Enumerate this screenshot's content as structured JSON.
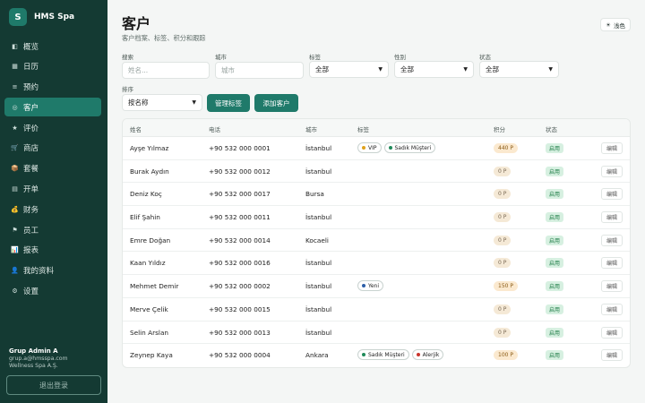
{
  "brand": {
    "logo": "S",
    "name": "HMS Spa"
  },
  "nav": [
    {
      "icon": "◧",
      "label": "概览",
      "active": false
    },
    {
      "icon": "▦",
      "label": "日历",
      "active": false
    },
    {
      "icon": "≡",
      "label": "预约",
      "active": false
    },
    {
      "icon": "◎",
      "label": "客户",
      "active": true
    },
    {
      "icon": "★",
      "label": "评价",
      "active": false
    },
    {
      "icon": "🛒",
      "label": "商店",
      "active": false
    },
    {
      "icon": "📦",
      "label": "套餐",
      "active": false
    },
    {
      "icon": "▤",
      "label": "开单",
      "active": false
    },
    {
      "icon": "💰",
      "label": "财务",
      "active": false
    },
    {
      "icon": "⚑",
      "label": "员工",
      "active": false
    },
    {
      "icon": "📊",
      "label": "报表",
      "active": false
    },
    {
      "icon": "👤",
      "label": "我的资料",
      "active": false
    },
    {
      "icon": "⚙",
      "label": "设置",
      "active": false
    }
  ],
  "user": {
    "name": "Grup Admin A",
    "email": "grup.a@hmsspa.com",
    "company": "Wellness Spa A.Ş."
  },
  "logout_label": "退出登录",
  "page": {
    "title": "客户",
    "subtitle": "客户档案、标签、积分和跟踪"
  },
  "theme_button": {
    "icon": "☀",
    "label": "浅色"
  },
  "filters": {
    "search_label": "搜索",
    "search_placeholder": "姓名...",
    "city_label": "城市",
    "city_placeholder": "城市",
    "tag_label": "标签",
    "tag_value": "全部",
    "gender_label": "性别",
    "gender_value": "全部",
    "status_label": "状态",
    "status_value": "全部",
    "sort_label": "排序",
    "sort_value": "按名称"
  },
  "buttons": {
    "manage_tags": "管理标签",
    "add_customer": "添加客户"
  },
  "table": {
    "headers": {
      "name": "姓名",
      "phone": "电话",
      "city": "城市",
      "tags": "标签",
      "points": "积分",
      "status": "状态"
    },
    "edit_label": "编辑",
    "rows": [
      {
        "name": "Ayşe Yılmaz",
        "phone": "+90 532 000 0001",
        "city": "İstanbul",
        "tags": [
          {
            "label": "VIP",
            "color": "#e0a21b"
          },
          {
            "label": "Sadık Müşteri",
            "color": "#1f8a5a"
          }
        ],
        "points": "440 P",
        "status": "启用"
      },
      {
        "name": "Burak Aydın",
        "phone": "+90 532 000 0012",
        "city": "İstanbul",
        "tags": [],
        "points": "0 P",
        "status": "启用"
      },
      {
        "name": "Deniz Koç",
        "phone": "+90 532 000 0017",
        "city": "Bursa",
        "tags": [],
        "points": "0 P",
        "status": "启用"
      },
      {
        "name": "Elif Şahin",
        "phone": "+90 532 000 0011",
        "city": "İstanbul",
        "tags": [],
        "points": "0 P",
        "status": "启用"
      },
      {
        "name": "Emre Doğan",
        "phone": "+90 532 000 0014",
        "city": "Kocaeli",
        "tags": [],
        "points": "0 P",
        "status": "启用"
      },
      {
        "name": "Kaan Yıldız",
        "phone": "+90 532 000 0016",
        "city": "İstanbul",
        "tags": [],
        "points": "0 P",
        "status": "启用"
      },
      {
        "name": "Mehmet Demir",
        "phone": "+90 532 000 0002",
        "city": "İstanbul",
        "tags": [
          {
            "label": "Yeni",
            "color": "#2d5fa8"
          }
        ],
        "points": "150 P",
        "status": "启用"
      },
      {
        "name": "Merve Çelik",
        "phone": "+90 532 000 0015",
        "city": "İstanbul",
        "tags": [],
        "points": "0 P",
        "status": "启用"
      },
      {
        "name": "Selin Arslan",
        "phone": "+90 532 000 0013",
        "city": "İstanbul",
        "tags": [],
        "points": "0 P",
        "status": "启用"
      },
      {
        "name": "Zeynep Kaya",
        "phone": "+90 532 000 0004",
        "city": "Ankara",
        "tags": [
          {
            "label": "Sadık Müşteri",
            "color": "#1f8a5a"
          },
          {
            "label": "Alerjik",
            "color": "#c9342c"
          }
        ],
        "points": "100 P",
        "status": "启用"
      }
    ]
  }
}
